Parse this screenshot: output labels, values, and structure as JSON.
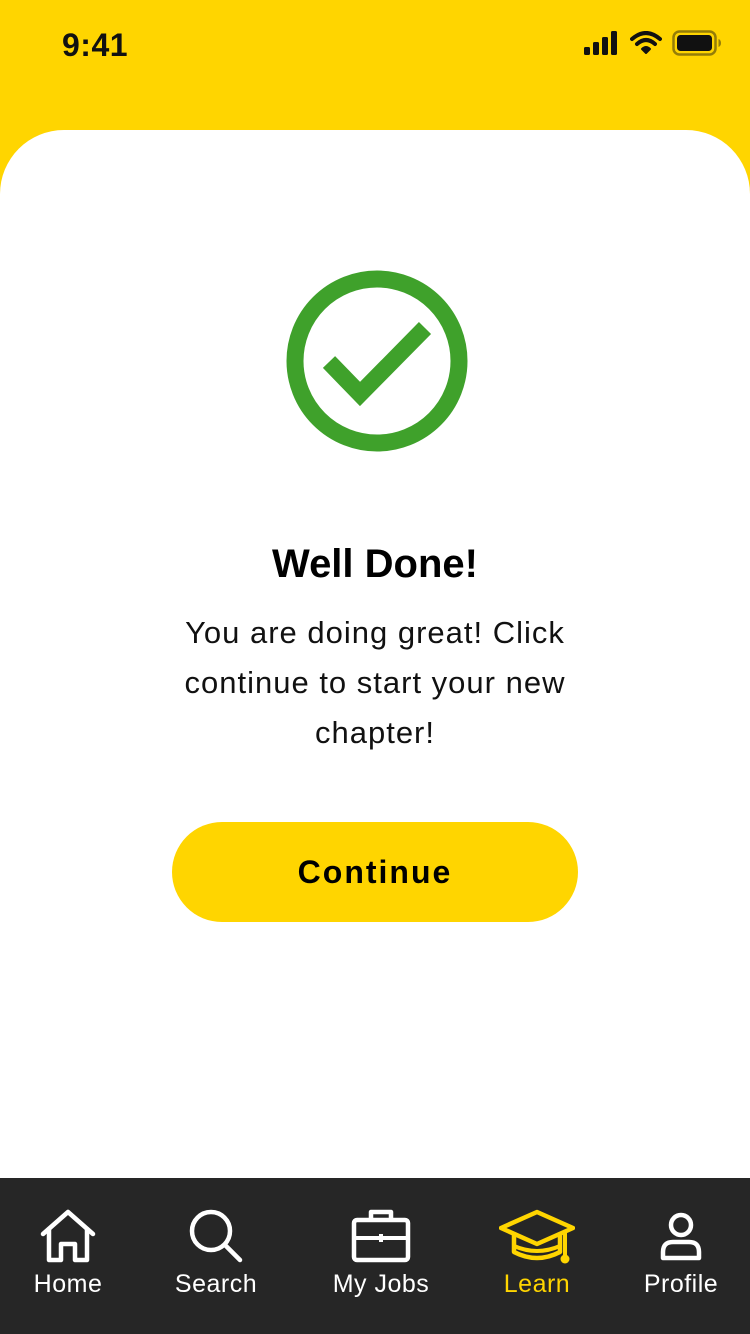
{
  "status_bar": {
    "time": "9:41"
  },
  "content": {
    "title": "Well Done!",
    "message": "You are doing great! Click continue to start your new chapter!",
    "continue_label": "Continue"
  },
  "tab_bar": {
    "items": [
      {
        "label": "Home",
        "icon": "home-icon",
        "active": false
      },
      {
        "label": "Search",
        "icon": "search-icon",
        "active": false
      },
      {
        "label": "My Jobs",
        "icon": "briefcase-icon",
        "active": false
      },
      {
        "label": "Learn",
        "icon": "graduation-cap-icon",
        "active": true
      },
      {
        "label": "Profile",
        "icon": "profile-icon",
        "active": false
      }
    ]
  },
  "colors": {
    "brand_yellow": "#FFD500",
    "success_green": "#3FA12B",
    "tab_bar_bg": "#262626",
    "tab_inactive": "#FFFFFF"
  }
}
